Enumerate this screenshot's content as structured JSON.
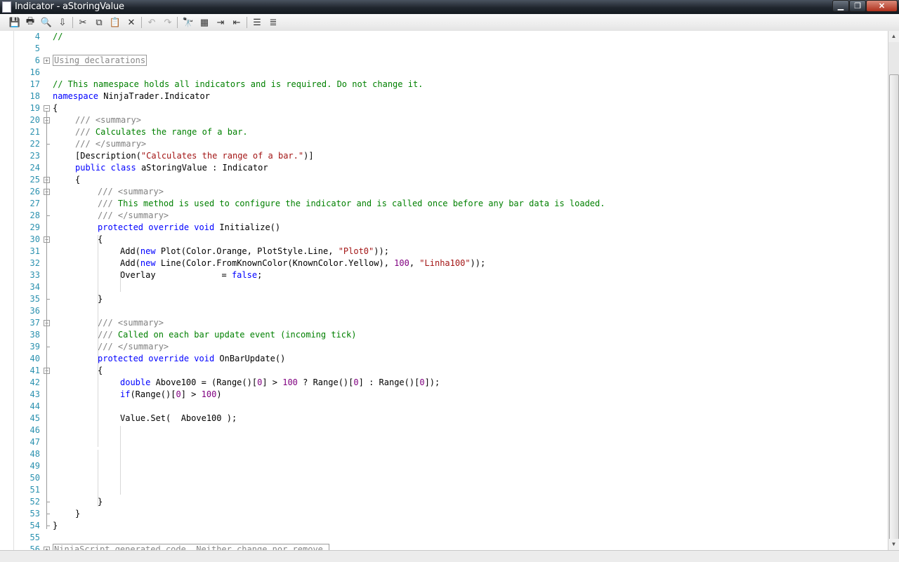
{
  "window": {
    "title": "Indicator - aStoringValue"
  },
  "window_buttons": {
    "minimize": "▁",
    "maximize": "❐",
    "close": "✕"
  },
  "toolbar": [
    {
      "icon": "save-icon",
      "glyph": "💾"
    },
    {
      "icon": "print-icon",
      "glyph": "🖶"
    },
    {
      "icon": "print-preview-icon",
      "glyph": "🔍"
    },
    {
      "icon": "compile-icon",
      "glyph": "⇩"
    },
    {
      "icon": "cut-icon",
      "glyph": "✂"
    },
    {
      "icon": "copy-icon",
      "glyph": "⧉"
    },
    {
      "icon": "paste-icon",
      "glyph": "📋"
    },
    {
      "icon": "delete-icon",
      "glyph": "✕"
    },
    {
      "icon": "undo-icon",
      "glyph": "↶"
    },
    {
      "icon": "redo-icon",
      "glyph": "↷"
    },
    {
      "icon": "find-icon",
      "glyph": "🔭"
    },
    {
      "icon": "replace-icon",
      "glyph": "▦"
    },
    {
      "icon": "indent-icon",
      "glyph": "⇥"
    },
    {
      "icon": "outdent-icon",
      "glyph": "⇤"
    },
    {
      "icon": "comment-icon",
      "glyph": "☰"
    },
    {
      "icon": "uncomment-icon",
      "glyph": "≣"
    }
  ],
  "code_lines": [
    {
      "n": "4",
      "indent": 0,
      "html": "<span class=\"cm\">//</span>"
    },
    {
      "n": "5",
      "indent": 0,
      "html": ""
    },
    {
      "n": "6",
      "indent": 0,
      "fold": "plus",
      "html": "<span class=\"region\">Using declarations</span>"
    },
    {
      "n": "16",
      "indent": 0,
      "html": ""
    },
    {
      "n": "17",
      "indent": 0,
      "html": "<span class=\"cm\">// This namespace holds all indicators and is required. Do not change it.</span>"
    },
    {
      "n": "18",
      "indent": 0,
      "html": "<span class=\"kw\">namespace</span> NinjaTrader.Indicator"
    },
    {
      "n": "19",
      "indent": 0,
      "fold": "minus",
      "html": "{"
    },
    {
      "n": "20",
      "indent": 4,
      "fold": "minus",
      "html": "<span class=\"doc\">///</span> <span class=\"doc\">&lt;summary&gt;</span>"
    },
    {
      "n": "21",
      "indent": 4,
      "html": "<span class=\"doc\">///</span><span class=\"cm\"> Calculates the range of a bar.</span>"
    },
    {
      "n": "22",
      "indent": 4,
      "fold": "end",
      "html": "<span class=\"doc\">/// &lt;/summary&gt;</span>"
    },
    {
      "n": "23",
      "indent": 4,
      "html": "[Description(<span class=\"str\">\"Calculates the range of a bar.\"</span>)]"
    },
    {
      "n": "24",
      "indent": 4,
      "html": "<span class=\"kw\">public</span> <span class=\"kw\">class</span> aStoringValue : Indicator"
    },
    {
      "n": "25",
      "indent": 4,
      "fold": "minus",
      "html": "{"
    },
    {
      "n": "26",
      "indent": 8,
      "fold": "minus",
      "html": "<span class=\"doc\">/// &lt;summary&gt;</span>"
    },
    {
      "n": "27",
      "indent": 8,
      "html": "<span class=\"doc\">///</span><span class=\"cm\"> This method is used to configure the indicator and is called once before any bar data is loaded.</span>"
    },
    {
      "n": "28",
      "indent": 8,
      "fold": "end",
      "html": "<span class=\"doc\">/// &lt;/summary&gt;</span>"
    },
    {
      "n": "29",
      "indent": 8,
      "html": "<span class=\"kw\">protected</span> <span class=\"kw\">override</span> <span class=\"kw\">void</span> Initialize()"
    },
    {
      "n": "30",
      "indent": 8,
      "fold": "minus",
      "html": "{"
    },
    {
      "n": "31",
      "indent": 12,
      "html": "Add(<span class=\"kw\">new</span> Plot(Color.Orange, PlotStyle.Line, <span class=\"str\">\"Plot0\"</span>));"
    },
    {
      "n": "32",
      "indent": 12,
      "html": "Add(<span class=\"kw\">new</span> Line(Color.FromKnownColor(KnownColor.Yellow), <span class=\"num\">100</span>, <span class=\"str\">\"Linha100\"</span>));"
    },
    {
      "n": "33",
      "indent": 12,
      "html": "Overlay             = <span class=\"kw\">false</span>;"
    },
    {
      "n": "34",
      "indent": 12,
      "html": ""
    },
    {
      "n": "35",
      "indent": 8,
      "fold": "end",
      "html": "}"
    },
    {
      "n": "36",
      "indent": 8,
      "html": ""
    },
    {
      "n": "37",
      "indent": 8,
      "fold": "minus",
      "html": "<span class=\"doc\">/// &lt;summary&gt;</span>"
    },
    {
      "n": "38",
      "indent": 8,
      "html": "<span class=\"doc\">///</span><span class=\"cm\"> Called on each bar update event (incoming tick)</span>"
    },
    {
      "n": "39",
      "indent": 8,
      "fold": "end",
      "html": "<span class=\"doc\">/// &lt;/summary&gt;</span>"
    },
    {
      "n": "40",
      "indent": 8,
      "html": "<span class=\"kw\">protected</span> <span class=\"kw\">override</span> <span class=\"kw\">void</span> OnBarUpdate()"
    },
    {
      "n": "41",
      "indent": 8,
      "fold": "minus",
      "html": "{"
    },
    {
      "n": "42",
      "indent": 12,
      "html": "<span class=\"kw\">double</span> Above100 = (Range()[<span class=\"num\">0</span>] &gt; <span class=\"num\">100</span> ? Range()[<span class=\"num\">0</span>] : Range()[<span class=\"num\">0</span>]);"
    },
    {
      "n": "43",
      "indent": 12,
      "html": "<span class=\"kw\">if</span>(Range()[<span class=\"num\">0</span>] &gt; <span class=\"num\">100</span>)"
    },
    {
      "n": "44",
      "indent": 12,
      "html": ""
    },
    {
      "n": "45",
      "indent": 12,
      "html": "Value.Set(  Above100 );"
    },
    {
      "n": "46",
      "indent": 12,
      "html": ""
    },
    {
      "n": "47",
      "indent": 12,
      "html": ""
    },
    {
      "n": "48",
      "indent": 12,
      "html": ""
    },
    {
      "n": "49",
      "indent": 12,
      "html": ""
    },
    {
      "n": "50",
      "indent": 12,
      "html": ""
    },
    {
      "n": "51",
      "indent": 12,
      "html": ""
    },
    {
      "n": "52",
      "indent": 8,
      "fold": "end",
      "html": "}"
    },
    {
      "n": "53",
      "indent": 4,
      "fold": "end",
      "html": "}"
    },
    {
      "n": "54",
      "indent": 0,
      "fold": "end",
      "html": "}"
    },
    {
      "n": "55",
      "indent": 0,
      "html": ""
    },
    {
      "n": "56",
      "indent": 0,
      "fold": "plus",
      "html": "<span class=\"region\">NinjaScript generated code. Neither change nor remove.</span>"
    }
  ]
}
